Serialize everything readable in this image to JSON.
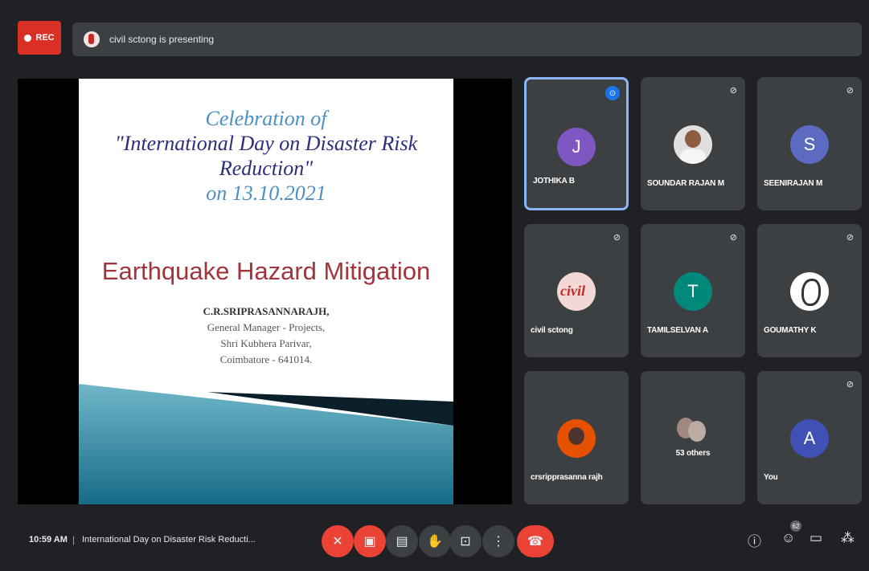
{
  "topbar": {
    "rec_label": "REC",
    "presenting_text": "civil sctong is presenting"
  },
  "slide": {
    "heading_lines": [
      "Celebration of",
      "\"International Day on Disaster Risk",
      "Reduction\"",
      "on 13.10.2021"
    ],
    "title": "Earthquake Hazard Mitigation",
    "author_lines": [
      "C.R.SRIPRASANNARAJH,",
      "General Manager - Projects,",
      "Shri Kubhera Parivar,",
      "Coimbatore - 641014."
    ]
  },
  "participants": [
    {
      "name": "JOTHIKA B",
      "initial": "J",
      "avatar_color": "#7e57c2",
      "active": true
    },
    {
      "name": "SOUNDAR RAJAN M",
      "avatar_type": "photo",
      "muted": true
    },
    {
      "name": "SEENIRAJAN M",
      "initial": "S",
      "avatar_color": "#5c6bc0",
      "muted": true
    },
    {
      "name": "civil sctong",
      "avatar_type": "logo",
      "muted": true
    },
    {
      "name": "TAMILSELVAN A",
      "initial": "T",
      "avatar_color": "#00897b",
      "muted": true
    },
    {
      "name": "GOUMATHY K",
      "avatar_type": "sketch",
      "muted": true
    },
    {
      "name": "crsripprasanna rajh",
      "avatar_type": "photo"
    },
    {
      "name": "53 others",
      "avatar_type": "group"
    },
    {
      "name": "You",
      "initial": "A",
      "avatar_color": "#3f51b5",
      "muted": true
    }
  ],
  "bottombar": {
    "time": "10:59 AM",
    "separator": "|",
    "meeting_title": "International Day on Disaster Risk Reducti...",
    "participant_count": "62"
  },
  "icons": {
    "mic": "mic-off-icon",
    "camera": "camera-off-icon",
    "captions": "captions-icon",
    "hand": "raise-hand-icon",
    "present": "present-icon",
    "more": "more-icon",
    "end": "end-call-icon",
    "info": "info-icon",
    "people": "people-icon",
    "chat": "chat-icon",
    "activities": "activities-icon"
  }
}
